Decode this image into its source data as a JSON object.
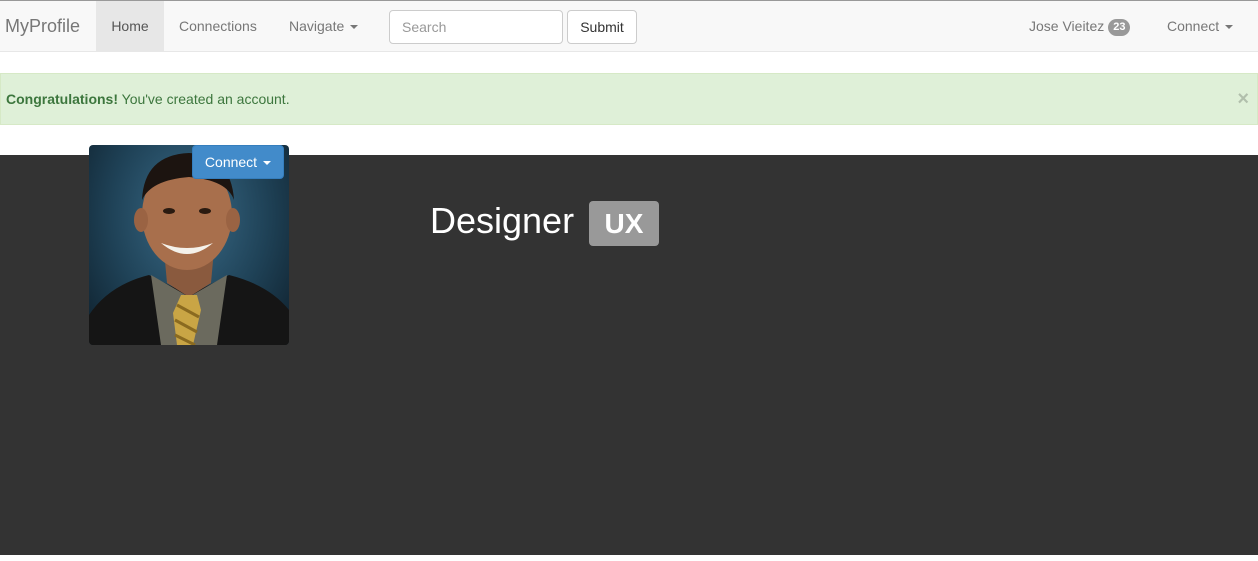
{
  "navbar": {
    "brand": "MyProfile",
    "items": [
      {
        "label": "Home",
        "active": true
      },
      {
        "label": "Connections"
      },
      {
        "label": "Navigate"
      }
    ],
    "search": {
      "placeholder": "Search",
      "value": ""
    },
    "submit_label": "Submit",
    "user": {
      "name": "Jose Vieitez",
      "badge_count": "23"
    },
    "connect_label": "Connect"
  },
  "alert": {
    "strong": "Congratulations!",
    "message": " You've created an account.",
    "close": "×",
    "type": "success"
  },
  "profile": {
    "connect_label": "Connect",
    "title": "Designer",
    "role_badge": "UX"
  },
  "colors": {
    "navbar_bg": "#f8f8f8",
    "alert_bg": "#dff0d8",
    "alert_text": "#3c763d",
    "hero_bg": "#333333",
    "primary": "#428bca",
    "badge": "#999999"
  }
}
